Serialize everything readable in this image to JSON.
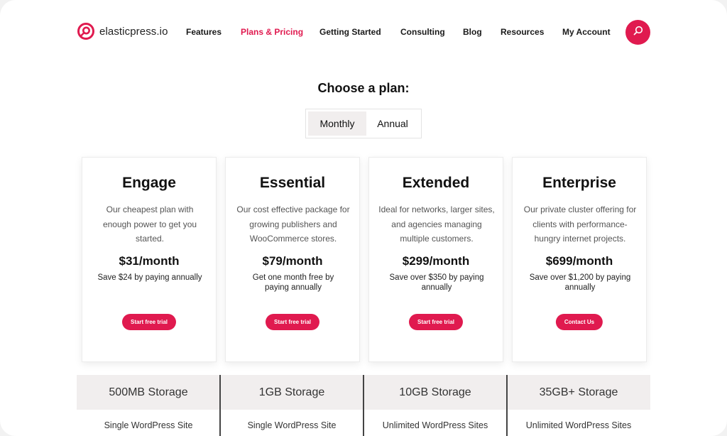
{
  "brand": {
    "name_prefix": "elastic",
    "name_suffix": "press.io",
    "color": "#e01a4f"
  },
  "nav": {
    "items": [
      {
        "label": "Features",
        "active": false
      },
      {
        "label": "Plans & Pricing",
        "active": true
      },
      {
        "label": "Getting Started",
        "active": false
      },
      {
        "label": "Consulting",
        "active": false
      },
      {
        "label": "Blog",
        "active": false
      },
      {
        "label": "Resources",
        "active": false
      },
      {
        "label": "My Account",
        "active": false
      }
    ],
    "search_icon": "search-icon"
  },
  "heading": "Choose a plan:",
  "billing_toggle": {
    "options": [
      "Monthly",
      "Annual"
    ],
    "selected": "Monthly"
  },
  "plans": [
    {
      "name": "Engage",
      "description": "Our cheapest plan with enough power to get you started.",
      "price": "$31/month",
      "savings": "Save $24 by paying annually",
      "cta": "Start free trial",
      "storage": "500MB Storage",
      "sites": "Single WordPress Site"
    },
    {
      "name": "Essential",
      "description": "Our cost effective package for growing publishers and WooCommerce stores.",
      "price": "$79/month",
      "savings": "Get one month free by paying annually",
      "cta": "Start free trial",
      "storage": "1GB Storage",
      "sites": "Single WordPress Site"
    },
    {
      "name": "Extended",
      "description": "Ideal for networks, larger sites, and agencies managing multiple customers.",
      "price": "$299/month",
      "savings": "Save over $350 by paying annually",
      "cta": "Start free trial",
      "storage": "10GB Storage",
      "sites": "Unlimited WordPress Sites"
    },
    {
      "name": "Enterprise",
      "description": "Our private cluster offering for clients with performance-hungry internet projects.",
      "price": "$699/month",
      "savings": "Save over $1,200 by paying annually",
      "cta": "Contact Us",
      "storage": "35GB+ Storage",
      "sites": "Unlimited WordPress Sites"
    }
  ]
}
